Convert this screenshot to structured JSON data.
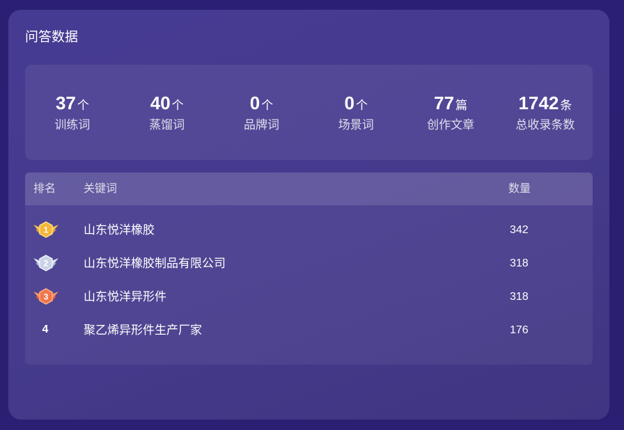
{
  "panel": {
    "title": "问答数据"
  },
  "stats": [
    {
      "value": "37",
      "unit": "个",
      "label": "训练词"
    },
    {
      "value": "40",
      "unit": "个",
      "label": "蒸馏词"
    },
    {
      "value": "0",
      "unit": "个",
      "label": "品牌词"
    },
    {
      "value": "0",
      "unit": "个",
      "label": "场景词"
    },
    {
      "value": "77",
      "unit": "篇",
      "label": "创作文章"
    },
    {
      "value": "1742",
      "unit": "条",
      "label": "总收录条数"
    }
  ],
  "table": {
    "headers": {
      "rank": "排名",
      "keyword": "关键词",
      "count": "数量"
    },
    "rows": [
      {
        "rank": "1",
        "medal": "gold-medal-icon",
        "keyword": "山东悦洋橡胶",
        "count": "342"
      },
      {
        "rank": "2",
        "medal": "silver-medal-icon",
        "keyword": "山东悦洋橡胶制品有限公司",
        "count": "318"
      },
      {
        "rank": "3",
        "medal": "bronze-medal-icon",
        "keyword": "山东悦洋异形件",
        "count": "318"
      },
      {
        "rank": "4",
        "medal": "",
        "keyword": "聚乙烯异形件生产厂家",
        "count": "176"
      }
    ]
  },
  "colors": {
    "background": "#2a1f72",
    "card": "#463b93",
    "gold": "#f5b63a",
    "silver": "#c9d3e6",
    "bronze": "#f2754a"
  }
}
